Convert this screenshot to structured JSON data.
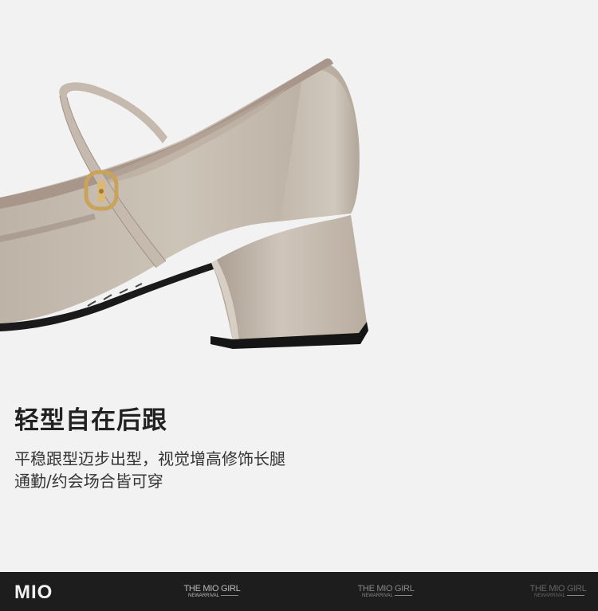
{
  "feature": {
    "headline": "轻型自在后跟",
    "description_lines": [
      "平稳跟型迈步出型，视觉增高修饰长腿",
      "通勤/约会场合皆可穿"
    ]
  },
  "footer": {
    "logo": "MIO",
    "watermarks": [
      {
        "title": "THE MIO GIRL",
        "subtitle": "NEWARRIVAL"
      },
      {
        "title": "THE MIO GIRL",
        "subtitle": "NEWARRIVAL"
      },
      {
        "title": "THE MIO GIRL",
        "subtitle": "NEWARRIVAL"
      }
    ]
  },
  "colors": {
    "background": "#f2f2f2",
    "shoe_leather": "#c9bfb2",
    "trim_velvet": "#a8968a",
    "buckle_gold": "#c9a35a",
    "footer": "#1d1d1d"
  },
  "icons": [
    "mary-jane-shoe-photo"
  ]
}
